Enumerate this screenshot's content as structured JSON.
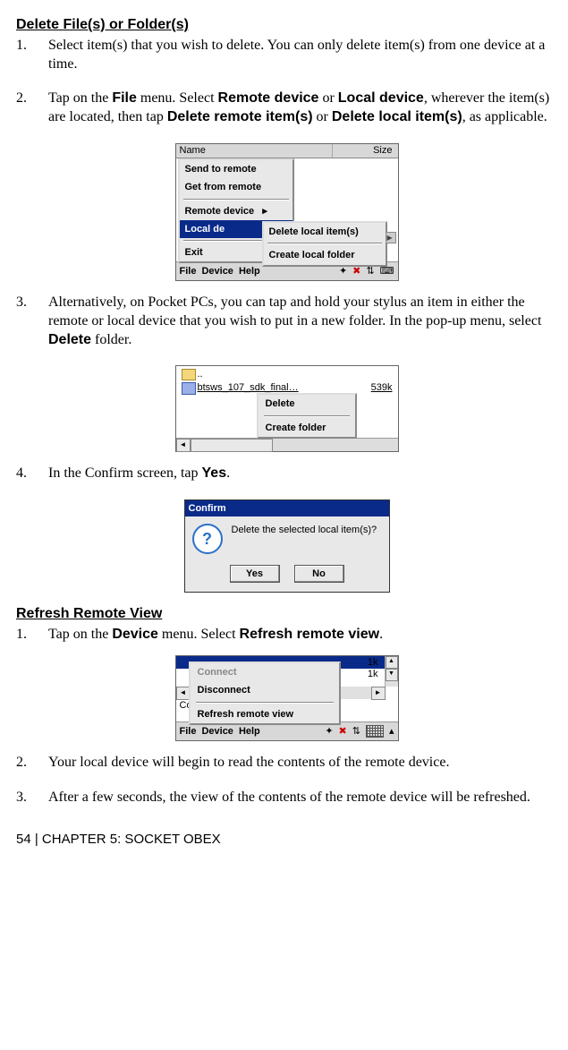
{
  "section1": {
    "heading": "Delete File(s) or Folder(s)",
    "items": [
      {
        "num": "1.",
        "html": "Select item(s) that you wish to delete. You can only delete item(s) from one device at a time."
      },
      {
        "num": "2.",
        "pre": "Tap on the ",
        "b1": "File",
        "mid1": " menu. Select ",
        "b2": "Remote device",
        "mid2": " or ",
        "b3": "Local device",
        "mid3": ", wherever the item(s) are located, then tap ",
        "b4": "Delete remote item(s)",
        "mid4": " or ",
        "b5": "Delete local item(s)",
        "post": ", as applicable."
      },
      {
        "num": "3.",
        "pre": "Alternatively, on Pocket PCs, you can tap and hold your stylus an item in either the remote or local device that you wish to put in a new folder. In the pop-up menu, select ",
        "b1": "Delete",
        "post": " folder."
      },
      {
        "num": "4.",
        "pre": "In the Confirm screen, tap ",
        "b1": "Yes",
        "post": "."
      }
    ]
  },
  "section2": {
    "heading": "Refresh Remote View",
    "items": [
      {
        "num": "1.",
        "pre": "Tap on the ",
        "b1": "Device",
        "mid1": " menu. Select ",
        "b2": "Refresh remote view",
        "post": "."
      },
      {
        "num": "2.",
        "text": "Your local device will begin to read the contents of the remote device."
      },
      {
        "num": "3.",
        "text": "After a few seconds, the view of the contents of the remote device will be refreshed."
      }
    ]
  },
  "ss1": {
    "header_name": "Name",
    "header_size": "Size",
    "menu": {
      "send": "Send to remote",
      "get": "Get from remote",
      "remote": "Remote device",
      "remote_arrow": "▸",
      "local": "Local de",
      "local_arrow": "▸",
      "exit": "Exit"
    },
    "submenu": {
      "delete": "Delete local item(s)",
      "create": "Create local folder"
    },
    "toolbar": {
      "file": "File",
      "device": "Device",
      "help": "Help"
    }
  },
  "ss2": {
    "folder_dots": "..",
    "filename": "btsws_107_sdk_final…",
    "filesize": "539k",
    "ctx": {
      "delete": "Delete",
      "create": "Create folder"
    }
  },
  "ss3": {
    "title": "Confirm",
    "msg": "Delete the selected local item(s)?",
    "yes": "Yes",
    "no": "No",
    "q": "?"
  },
  "ss4": {
    "size1": "1k",
    "size2": "1k",
    "con": "Con",
    "menu": {
      "connect": "Connect",
      "disconnect": "Disconnect",
      "refresh": "Refresh remote view"
    },
    "toolbar": {
      "file": "File",
      "device": "Device",
      "help": "Help"
    }
  },
  "footer": "54  | CHAPTER 5: SOCKET OBEX"
}
